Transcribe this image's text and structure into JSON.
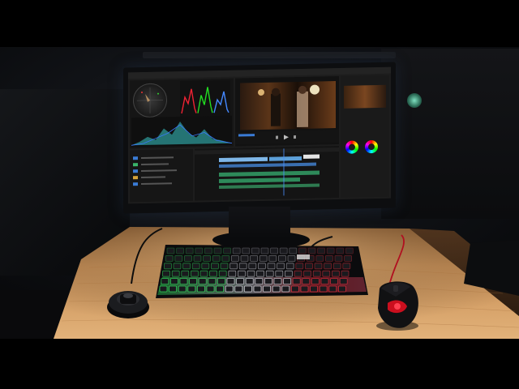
{
  "scene": {
    "description_label": "",
    "colors": {
      "desk_light": "#d6a56b",
      "desk_dark": "#8a5a2e",
      "screen_bg": "#1d1d1d",
      "keyboard_rgb_green": "#33ff66",
      "keyboard_rgb_red": "#ff3040",
      "keyboard_rgb_white": "#f5f5ff",
      "mouse_red": "#e01020"
    }
  },
  "screen": {
    "menu_items": [
      "",
      "",
      "",
      "",
      "",
      "",
      "",
      "",
      "",
      "",
      "",
      "",
      ""
    ],
    "panels": [
      "lumetri-scopes",
      "program-monitor",
      "lumetri-color",
      "project",
      "timeline"
    ]
  },
  "icons": {
    "monitor": "monitor-icon",
    "keyboard": "keyboard-icon",
    "mouse": "mouse-icon",
    "volume_knob": "volume-knob-icon",
    "logo": "logo-badge-icon"
  }
}
